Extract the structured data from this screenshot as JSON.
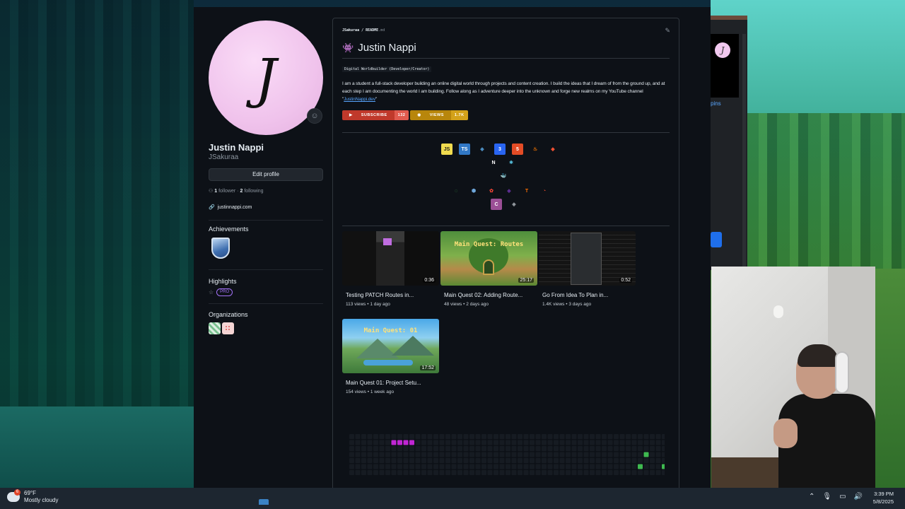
{
  "profile": {
    "avatar_letter": "J",
    "name": "Justin Nappi",
    "username": "JSakuraa",
    "edit_label": "Edit profile",
    "followers": "1",
    "followers_label": "follower",
    "following": "2",
    "following_label": "following",
    "website": "justinnappi.com"
  },
  "sections": {
    "achievements": "Achievements",
    "highlights": "Highlights",
    "pro_badge": "PRO",
    "organizations": "Organizations"
  },
  "readme": {
    "path_user": "JSakuraa",
    "path_file": "README",
    "path_ext": ".md",
    "title": "Justin Nappi",
    "tag": "Digital Worldbuilder (Developer/Creator)",
    "body_text": "I am a student a full-stack developer building an online digital world through projects and content creation. I build the ideas that I dream of from the ground up, and at each step I am documenting the world I am building. Follow along as I adventure deeper into the unknown and forge new realms on my YouTube channel \"",
    "body_link": "JustinNappi.dev",
    "body_end": "\"",
    "shields": {
      "subscribe_label": "SUBSCRIBE",
      "subscribe_value": "132",
      "views_label": "VIEWS",
      "views_value": "1.7K"
    }
  },
  "tech_icons": {
    "row1": [
      {
        "name": "javascript",
        "label": "JS",
        "bg": "#f0db4f",
        "fg": "#1b1b1b"
      },
      {
        "name": "typescript",
        "label": "TS",
        "bg": "#3178c6",
        "fg": "#ffffff"
      },
      {
        "name": "python",
        "label": "◆",
        "bg": "transparent",
        "fg": "#4b8bbe"
      },
      {
        "name": "css3",
        "label": "3",
        "bg": "#2965f1",
        "fg": "#ffffff"
      },
      {
        "name": "html5",
        "label": "5",
        "bg": "#e34c26",
        "fg": "#ffffff"
      },
      {
        "name": "java",
        "label": "♨",
        "bg": "transparent",
        "fg": "#e76f00"
      },
      {
        "name": "git",
        "label": "◆",
        "bg": "transparent",
        "fg": "#f05032"
      }
    ],
    "row2": [
      {
        "name": "nextjs",
        "label": "N",
        "bg": "#0d1117",
        "fg": "#ffffff"
      },
      {
        "name": "react",
        "label": "⚛",
        "bg": "transparent",
        "fg": "#61dafb"
      }
    ],
    "row3": [
      {
        "name": "docker",
        "label": "🐳",
        "bg": "transparent",
        "fg": "#2496ed"
      }
    ],
    "row4": [
      {
        "name": "spinner",
        "label": "◌",
        "bg": "transparent",
        "fg": "#3fb950"
      },
      {
        "name": "cube",
        "label": "⬢",
        "bg": "transparent",
        "fg": "#6fa8dc"
      },
      {
        "name": "blender",
        "label": "✿",
        "bg": "transparent",
        "fg": "#ea4335"
      },
      {
        "name": "visualstudio",
        "label": "◆",
        "bg": "transparent",
        "fg": "#5c2d91"
      },
      {
        "name": "tensorflow",
        "label": "T",
        "bg": "transparent",
        "fg": "#ff6f00"
      },
      {
        "name": "pytorch",
        "label": "◔",
        "bg": "transparent",
        "fg": "#ee4c2c"
      }
    ],
    "row5": [
      {
        "name": "csharp",
        "label": "C",
        "bg": "#9b4f96",
        "fg": "#ffffff"
      },
      {
        "name": "unity",
        "label": "◈",
        "bg": "transparent",
        "fg": "#9aa0a6"
      }
    ]
  },
  "videos": [
    {
      "title": "Testing PATCH Routes in...",
      "views": "113 views",
      "age": "1 day ago",
      "duration": "0:36",
      "thumb_text": ""
    },
    {
      "title": "Main Quest 02: Adding Route...",
      "views": "48 views",
      "age": "2 days ago",
      "duration": "25:17",
      "thumb_text": "Main Quest: Routes"
    },
    {
      "title": "Go From Idea To Plan in...",
      "views": "1.4K views",
      "age": "3 days ago",
      "duration": "0:52",
      "thumb_text": ""
    },
    {
      "title": "Main Quest 01: Project Setu...",
      "views": "154 views",
      "age": "1 week ago",
      "duration": "17:52",
      "thumb_text": "Main Quest: 01"
    }
  ],
  "meta_sep": "•",
  "back_window": {
    "link_text": "pins"
  },
  "taskbar": {
    "temperature": "69°F",
    "weather": "Mostly cloudy",
    "alert_count": "6",
    "time": "3:39 PM",
    "date": "5/8/2025"
  },
  "colors": {
    "accent_link": "#58a6ff",
    "contrib_pink": "#c026d3",
    "contrib_green": "#3fb950",
    "bg": "#0d1117"
  }
}
